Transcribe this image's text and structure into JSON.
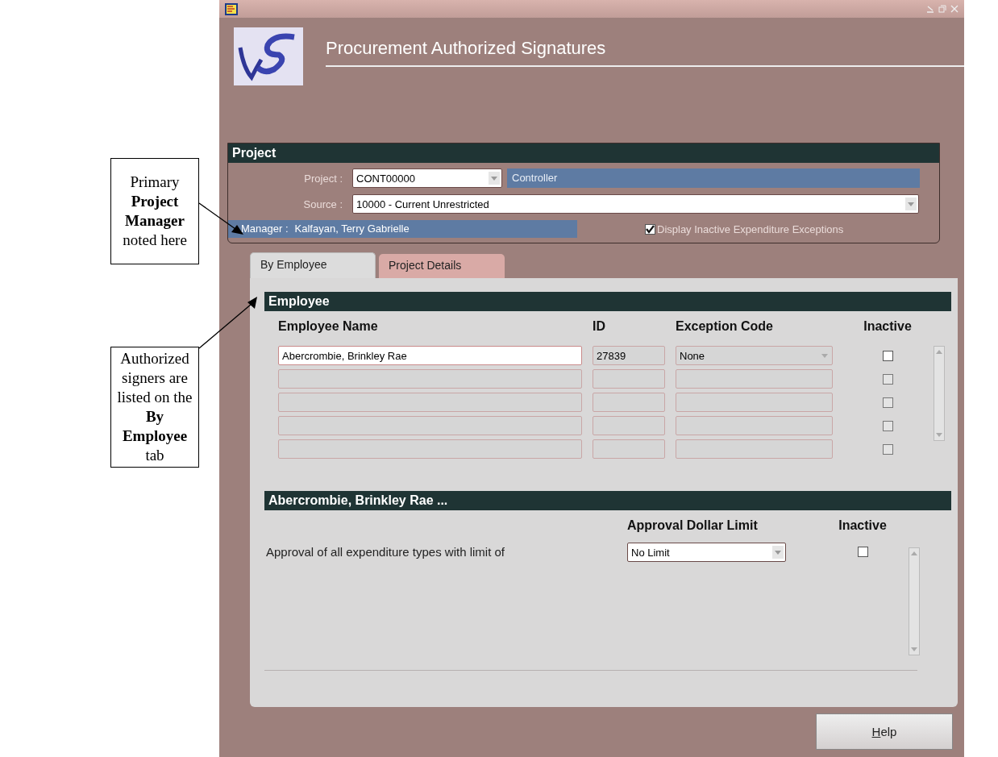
{
  "annotations": [
    {
      "kind": "callout",
      "text": "Primary **Project Manager** noted here"
    },
    {
      "kind": "callout",
      "text": "Authorized signers are listed on the **By Employee** tab"
    }
  ],
  "header": {
    "title": "Procurement Authorized Signatures"
  },
  "project_section": {
    "title": "Project",
    "project": {
      "label": "Project :",
      "value": "CONT00000",
      "description": "Controller"
    },
    "source": {
      "label": "Source :",
      "value": "10000 - Current Unrestricted"
    },
    "manager": {
      "label": "Manager :",
      "value": "Kalfayan, Terry Gabrielle"
    },
    "display_inactive": {
      "label": "Display Inactive Expenditure Exceptions",
      "checked": true
    }
  },
  "tabs": [
    {
      "label": "By Employee",
      "selected": true
    },
    {
      "label": "Project Details",
      "selected": false
    }
  ],
  "employee_section": {
    "title": "Employee",
    "columns": [
      "Employee Name",
      "ID",
      "Exception Code",
      "Inactive"
    ],
    "rows": [
      {
        "name": "Abercrombie, Brinkley Rae",
        "id": "27839",
        "exception_code": "None",
        "inactive": false,
        "current": true
      },
      {
        "inactive": false,
        "current": false
      },
      {
        "inactive": false,
        "current": false
      },
      {
        "inactive": false,
        "current": false
      },
      {
        "inactive": false,
        "current": false
      }
    ]
  },
  "limit_section": {
    "title": "Abercrombie, Brinkley Rae ...",
    "columns": [
      "Approval Dollar Limit",
      "Inactive"
    ],
    "rows": [
      {
        "description": "Approval of all expenditure types with limit of",
        "limit": "No Limit",
        "inactive": false
      }
    ]
  },
  "buttons": [
    {
      "label": "Help"
    }
  ]
}
